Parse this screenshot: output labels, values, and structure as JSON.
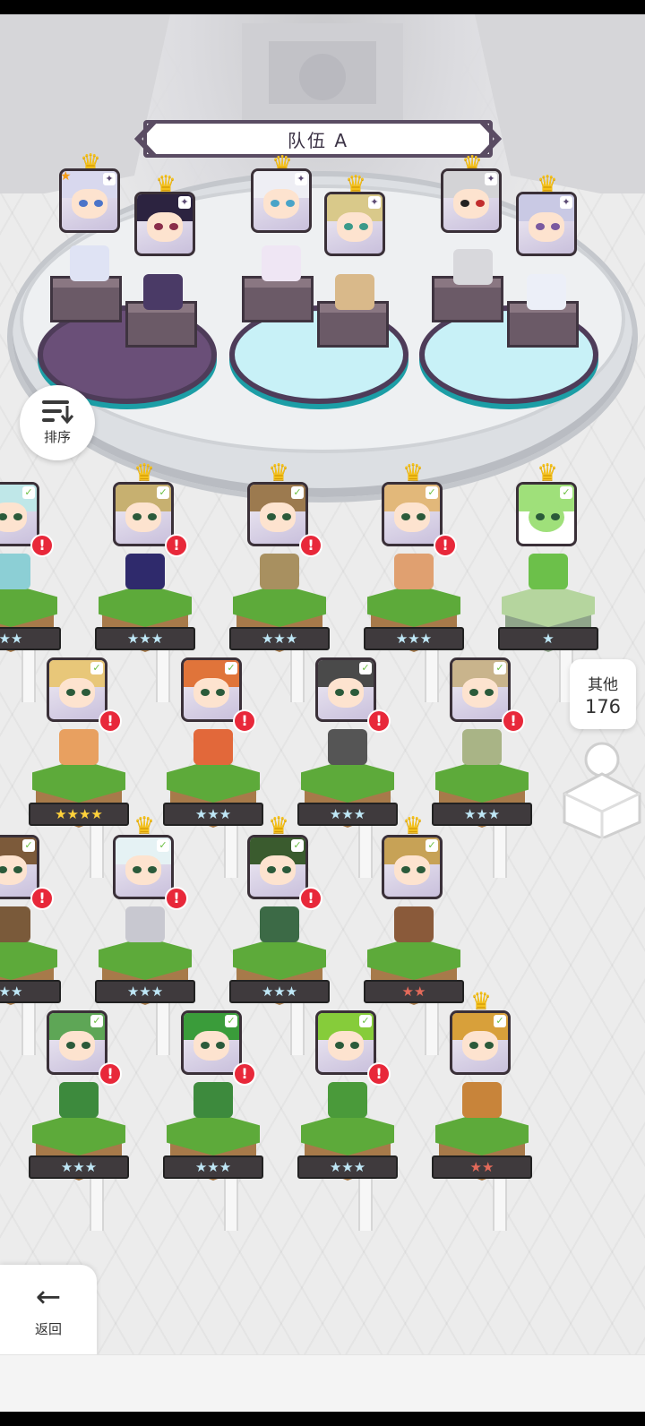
{
  "team": {
    "title": "队伍 A"
  },
  "sort_button": {
    "label": "排序"
  },
  "other_button": {
    "label": "其他",
    "count": "176"
  },
  "back_button": {
    "label": "返回"
  },
  "colors": {
    "alert": "#e8283a",
    "crown": "#f5c21b",
    "grass": "#5daa3a",
    "pad_cyan": "#c8f1f7",
    "pad_purple": "#6a4f78"
  },
  "roster": {
    "rows": [
      {
        "units": [
          {
            "stars": "★★",
            "star_color": "blue",
            "partial": true,
            "alert": true
          },
          {
            "stars": "★★★",
            "star_color": "blue",
            "crown": true,
            "alert": true
          },
          {
            "stars": "★★★",
            "star_color": "blue",
            "crown": true,
            "alert": true
          },
          {
            "stars": "★★★",
            "star_color": "blue",
            "crown": true,
            "alert": true
          },
          {
            "stars": "★",
            "star_color": "blue",
            "crown": true,
            "alert": false,
            "pale": true
          }
        ]
      },
      {
        "units": [
          {
            "stars": "★★★★",
            "star_color": "gold",
            "alert": true
          },
          {
            "stars": "★★★",
            "star_color": "blue",
            "alert": true
          },
          {
            "stars": "★★★",
            "star_color": "blue",
            "alert": true
          },
          {
            "stars": "★★★",
            "star_color": "blue",
            "alert": true
          }
        ]
      },
      {
        "units": [
          {
            "stars": "★★",
            "star_color": "blue",
            "partial": true,
            "alert": true
          },
          {
            "stars": "★★★",
            "star_color": "blue",
            "crown": true,
            "alert": true
          },
          {
            "stars": "★★★",
            "star_color": "blue",
            "crown": true,
            "alert": true
          },
          {
            "stars": "★★",
            "star_color": "red",
            "crown": true,
            "alert": false
          }
        ]
      },
      {
        "units": [
          {
            "stars": "★★★",
            "star_color": "blue",
            "alert": true
          },
          {
            "stars": "★★★",
            "star_color": "blue",
            "alert": true
          },
          {
            "stars": "★★★",
            "star_color": "blue",
            "alert": true
          },
          {
            "stars": "★★",
            "star_color": "red",
            "crown": true,
            "alert": false
          }
        ]
      }
    ]
  },
  "glyphs": {
    "alert": "!",
    "crown": "♛",
    "leaf": "✓",
    "spark": "✦",
    "star": "★",
    "arrow": "←"
  }
}
